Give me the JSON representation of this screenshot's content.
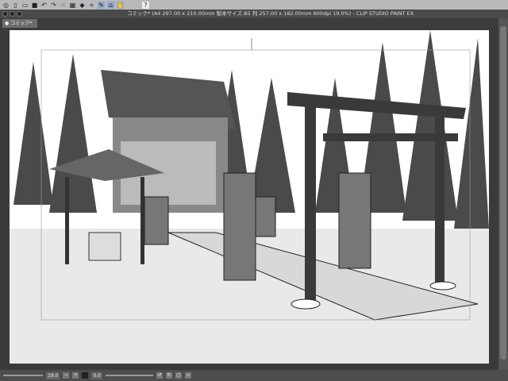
{
  "toolbar": {
    "icons": [
      "clip-studio-icon",
      "new-icon",
      "open-icon",
      "save-icon",
      "undo-icon",
      "redo-icon",
      "select-all-icon",
      "deselect-icon",
      "fill-icon",
      "transform-icon",
      "pen-icon",
      "bucket-icon",
      "hand-icon",
      "help-icon"
    ]
  },
  "window": {
    "title": "コミック* (A4 297.00 x 210.00mm 製本サイズ:B5 判 257.00 x 182.00mm 600dpi 19.0%) - CLIP STUDIO PAINT EX"
  },
  "tabs": [
    {
      "label": "コミック*"
    }
  ],
  "status": {
    "zoom": "19.0",
    "angle": "0.0"
  }
}
